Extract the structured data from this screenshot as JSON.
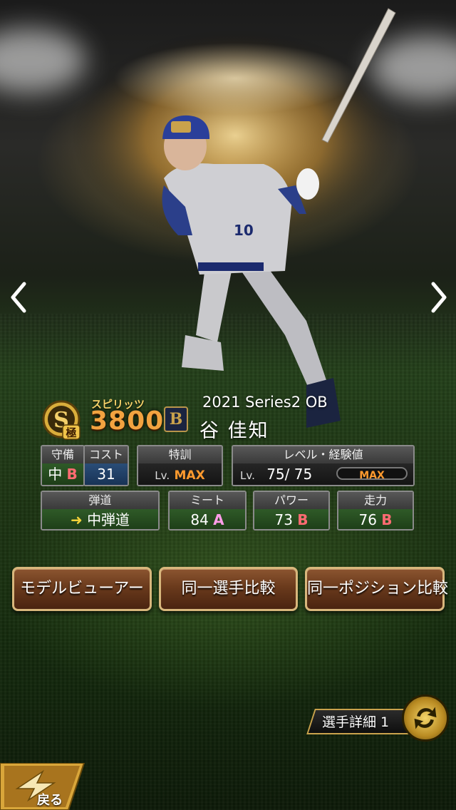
{
  "header": {
    "spirits_label": "スピリッツ",
    "spirits_value": "3800",
    "rank": "S",
    "rank_sub": "極",
    "team_logo": "B",
    "series": "2021 Series2 OB",
    "player_name": "谷 佳知"
  },
  "stats": {
    "defense_label": "守備",
    "defense_pos": "中",
    "defense_grade": "B",
    "cost_label": "コスト",
    "cost_value": "31",
    "training_label": "特訓",
    "training_lv": "Lv.",
    "training_value": "MAX",
    "level_label": "レベル・経験値",
    "level_lv": "Lv.",
    "level_value": "75/ 75",
    "level_bar": "MAX",
    "trajectory_label": "弾道",
    "trajectory_value": "中弾道",
    "meet_label": "ミート",
    "meet_value": "84",
    "meet_grade": "A",
    "power_label": "パワー",
    "power_value": "73",
    "power_grade": "B",
    "run_label": "走力",
    "run_value": "76",
    "run_grade": "B"
  },
  "buttons": {
    "model_viewer": "モデルビューアー",
    "same_player_compare": "同一選手比較",
    "same_position_compare": "同一ポジション比較",
    "player_detail": "選手詳細 1",
    "back": "戻る"
  },
  "colors": {
    "gold": "#c9a24c",
    "grade_b": "#ff6b72",
    "grade_a": "#ff9de8",
    "max": "#ff9a2e"
  }
}
